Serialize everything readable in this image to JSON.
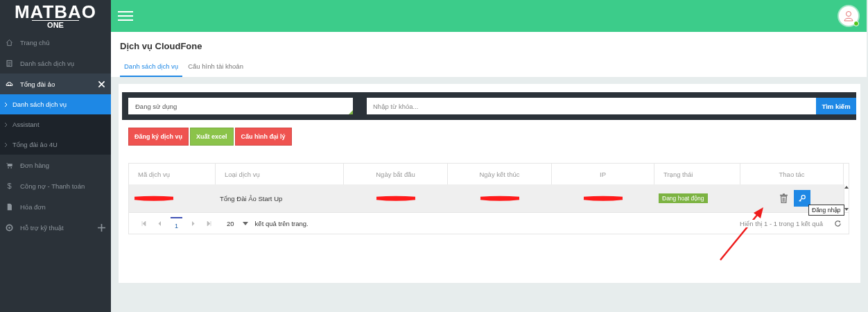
{
  "logo": {
    "title": "MATBAO",
    "subtitle": "ONE"
  },
  "sidebar": {
    "items": [
      {
        "kind": "link",
        "label": "Trang chủ",
        "selected": false
      },
      {
        "kind": "link",
        "label": "Danh sách dịch vụ",
        "selected": false
      },
      {
        "kind": "group",
        "label": "Tổng đài ảo",
        "selected": false,
        "expanded": true,
        "children": [
          {
            "label": "Danh sách dịch vụ",
            "selected": true
          },
          {
            "label": "Assistant",
            "selected": false
          },
          {
            "label": "Tổng đài ảo 4U",
            "selected": false
          }
        ]
      },
      {
        "kind": "link",
        "label": "Đơn hàng",
        "selected": false
      },
      {
        "kind": "link",
        "label": "Công nợ - Thanh toán",
        "icon_text": "$",
        "selected": false
      },
      {
        "kind": "link",
        "label": "Hóa đơn",
        "selected": false
      },
      {
        "kind": "group",
        "label": "Hỗ trợ kỹ thuật",
        "selected": false,
        "expanded": false
      }
    ]
  },
  "page": {
    "title": "Dịch vụ CloudFone"
  },
  "tabs": [
    {
      "label": "Danh sách dịch vụ",
      "selected": true
    },
    {
      "label": "Cấu hình tài khoản",
      "selected": false
    }
  ],
  "filter": {
    "status_value": "Đang sử dụng",
    "search_placeholder": "Nhập từ khóa...",
    "search_button": "Tìm kiếm"
  },
  "buttons": [
    {
      "label": "Đăng ký dịch vụ",
      "color": "#ef5350"
    },
    {
      "label": "Xuất excel",
      "color": "#8bc34a"
    },
    {
      "label": "Cấu hình đại lý",
      "color": "#ef5350"
    }
  ],
  "table": {
    "columns": [
      {
        "label": "Mã dịch vụ"
      },
      {
        "label": "Loại dịch vụ"
      },
      {
        "label": "Ngày bắt đầu"
      },
      {
        "label": "Ngày kết thúc"
      },
      {
        "label": "IP"
      },
      {
        "label": "Trạng thái"
      },
      {
        "label": "Thao tác"
      }
    ],
    "rows": [
      {
        "cells": [
          {
            "kind": "redacted"
          },
          {
            "kind": "text",
            "text": "Tổng Đài Ảo Start Up"
          },
          {
            "kind": "redacted"
          },
          {
            "kind": "redacted"
          },
          {
            "kind": "redacted"
          },
          {
            "kind": "status",
            "text": "Đang hoạt động",
            "color": "#7cb342"
          },
          {
            "kind": "actions",
            "tooltip": "Đăng nhập"
          }
        ]
      }
    ]
  },
  "pagination": {
    "pages": [
      {
        "label": "1",
        "selected": true
      }
    ],
    "page_size": "20",
    "page_size_label": "kết quả trên trang.",
    "summary": "Hiển thị 1 - 1 trong 1 kết quả"
  }
}
